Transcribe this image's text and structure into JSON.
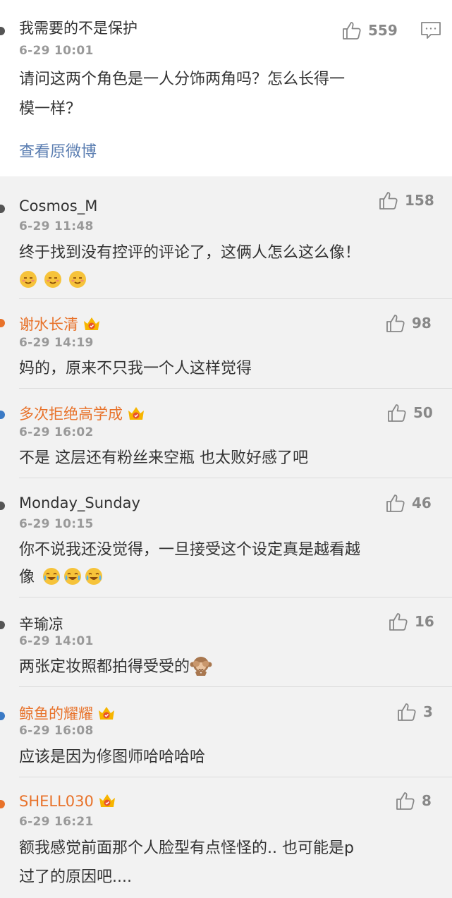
{
  "top_comment": {
    "user": "我需要的不是保护",
    "time": "6-29 10:01",
    "likes": "559",
    "text_line1": "请问这两个角色是一人分饰两角吗？怎么长得一",
    "text_line2": "模一样？",
    "view_original": "查看原微博"
  },
  "replies": [
    {
      "user": "Cosmos_M",
      "time": "6-29 11:48",
      "likes": "158",
      "text": "终于找到没有控评的评论了，这俩人怎么这么像！",
      "emojis": [
        "smirk-emoji",
        "smirk-emoji",
        "smirk-emoji"
      ]
    },
    {
      "user": "谢水长清",
      "time": "6-29 14:19",
      "likes": "98",
      "text": "妈的，原来不只我一个人这样觉得"
    },
    {
      "user": "多次拒绝高学成",
      "time": "6-29 16:02",
      "likes": "50",
      "text": "不是  这层还有粉丝来空瓶  也太败好感了吧"
    },
    {
      "user": "Monday_Sunday",
      "time": "6-29 10:15",
      "likes": "46",
      "text_line1": "你不说我还没觉得，一旦接受这个设定真是越看越",
      "text_line2": "像",
      "emojis": [
        "laugh-cry-emoji",
        "laugh-cry-emoji",
        "laugh-cry-emoji"
      ]
    },
    {
      "user": "辛瑜凉",
      "time": "6-29 14:01",
      "likes": "16",
      "text": "两张定妆照都拍得受受的",
      "emojis": [
        "see-no-evil-monkey-emoji"
      ]
    },
    {
      "user": "鲸鱼的耀耀",
      "time": "6-29 16:08",
      "likes": "3",
      "text": "应该是因为修图师哈哈哈哈"
    },
    {
      "user": "SHELL030",
      "time": "6-29 16:21",
      "likes": "8",
      "text_line1": "额我感觉前面那个人脸型有点怪怪的.. 也可能是p",
      "text_line2": "过了的原因吧...."
    }
  ],
  "colors": {
    "orange_name": "#e8722a",
    "link": "#5b7eb1",
    "meta": "#999999"
  },
  "icons": {
    "like": "thumbs-up-icon",
    "reply": "comment-icon",
    "vip": "crown-badge-icon"
  }
}
